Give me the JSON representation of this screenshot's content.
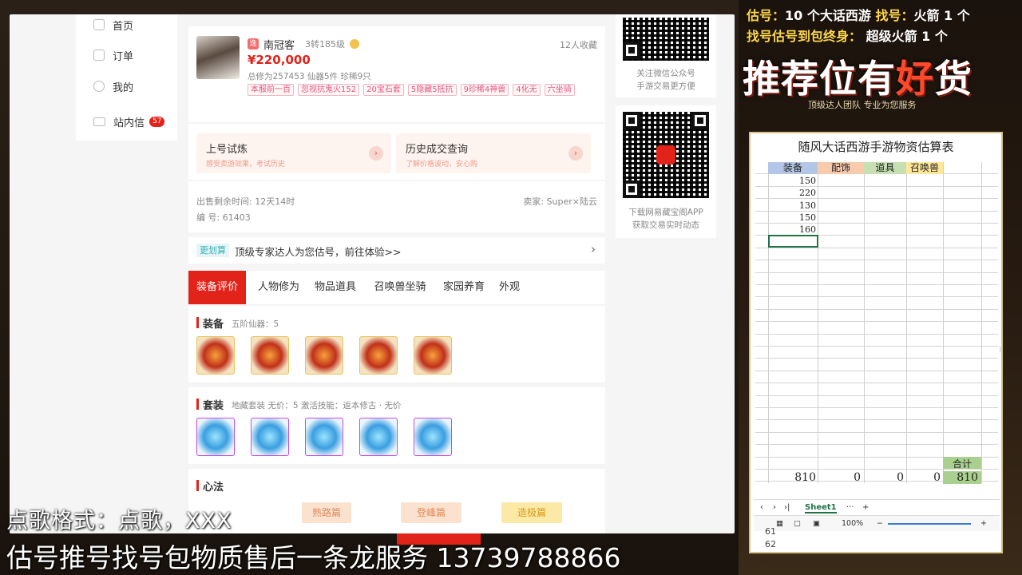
{
  "sidebar": {
    "items": [
      {
        "label": "首页"
      },
      {
        "label": "订单"
      },
      {
        "label": "我的"
      },
      {
        "label": "站内信",
        "badge": "57"
      }
    ]
  },
  "listing": {
    "seller_badge": "逸",
    "name": "南冠客",
    "level": "3转185级",
    "favorites": "12人收藏",
    "price": "¥220,000",
    "stats": "总修为257453  仙器5件  珍稀9只",
    "tags": [
      "本服前一百",
      "忽视抗鬼火152",
      "20宝石套",
      "5隐藏5抵抗",
      "9珍稀4神兽",
      "4化无",
      "六坐骑"
    ]
  },
  "links": [
    {
      "title": "上号试炼",
      "subtitle": "感受卖游效果，考试历史"
    },
    {
      "title": "历史成交查询",
      "subtitle": "了解价格波动，安心购"
    }
  ],
  "info": {
    "remaining": "出售剩余时间: 12天14时",
    "seller": "卖家: Super×陆云",
    "id": "编  号: 61403"
  },
  "promo": {
    "tag": "更划算",
    "text": "顶级专家达人为您估号，前往体验>>",
    "arrow": "›"
  },
  "tabs": [
    "装备评价",
    "人物修为",
    "物品道具",
    "召唤兽坐骑",
    "家园养育",
    "外观"
  ],
  "equip": {
    "title": "装备",
    "subtitle": "五阶仙器：5"
  },
  "suit": {
    "title": "套装",
    "subtitle": "地藏套装  无价：5  激活技能：返本修古 · 无价"
  },
  "heart": {
    "title": "心法",
    "items": [
      "熟路篇",
      "登峰篇",
      "造极篇"
    ]
  },
  "qr1": {
    "line1": "关注微信公众号",
    "line2": "手游交易更方便"
  },
  "qr2": {
    "line1": "下载网易藏宝阁APP",
    "line2": "获取交易实时动态"
  },
  "overlay": {
    "line1": "点歌格式：点歌，XXX",
    "line2": "估号推号找号包物质售后一条龙服务 13739788866"
  },
  "right_panel": {
    "hdr1_a": "估号：",
    "hdr1_b": "10 个大话西游",
    "hdr1_c": "找号：",
    "hdr1_d": "火箭 1 个",
    "hdr2_a": "找号估号到包终身：",
    "hdr2_b": "超级火箭 1 个",
    "big_a": "推荐位有",
    "big_b": "好",
    "big_c": "货",
    "small": "顶级达人团队  专业为您服务"
  },
  "sheet": {
    "title": "随风大话西游手游物资估算表",
    "headers": [
      "装备",
      "配饰",
      "道具",
      "召唤兽"
    ],
    "equip_values": [
      "150",
      "220",
      "130",
      "150",
      "160"
    ],
    "total_label": "合计",
    "totals": [
      "810",
      "0",
      "0",
      "0",
      "810"
    ],
    "tab_name": "Sheet1",
    "zoom": "100%",
    "row_a": "61",
    "row_b": "62",
    "side_num": "1"
  },
  "colors": {
    "accent": "#e2231a",
    "sheet_header": "#b4c6e7",
    "sheet_header2": "#f8cbad",
    "sheet_header3": "#c6e0b4",
    "total": "#a9d08e"
  }
}
